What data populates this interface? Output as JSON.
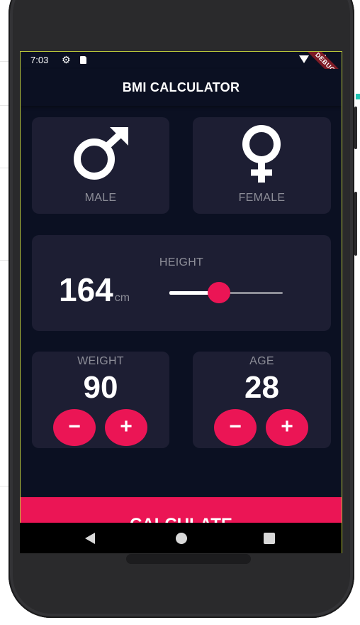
{
  "status_bar": {
    "time": "7:03",
    "debug_label": "DEBUG",
    "icons": [
      "gear-icon",
      "sd-card-icon",
      "wifi-icon",
      "battery-icon"
    ]
  },
  "app_bar": {
    "title": "BMI CALCULATOR"
  },
  "gender": {
    "male_label": "MALE",
    "female_label": "FEMALE",
    "male_icon": "mars-icon",
    "female_icon": "venus-icon",
    "male_glyph": "♂",
    "female_glyph": "♀"
  },
  "height": {
    "label": "HEIGHT",
    "value": "164",
    "unit": "cm",
    "slider_fraction": 0.44
  },
  "weight": {
    "label": "WEIGHT",
    "value": "90",
    "minus": "−",
    "plus": "+"
  },
  "age": {
    "label": "AGE",
    "value": "28",
    "minus": "−",
    "plus": "+"
  },
  "calculate": {
    "label": "CALCULATE"
  },
  "colors": {
    "background": "#0b1022",
    "card": "#1d1e33",
    "accent": "#eb1555",
    "label": "#8d8e98",
    "slider_track": "#8d8e98",
    "slider_active": "#ffffff"
  }
}
